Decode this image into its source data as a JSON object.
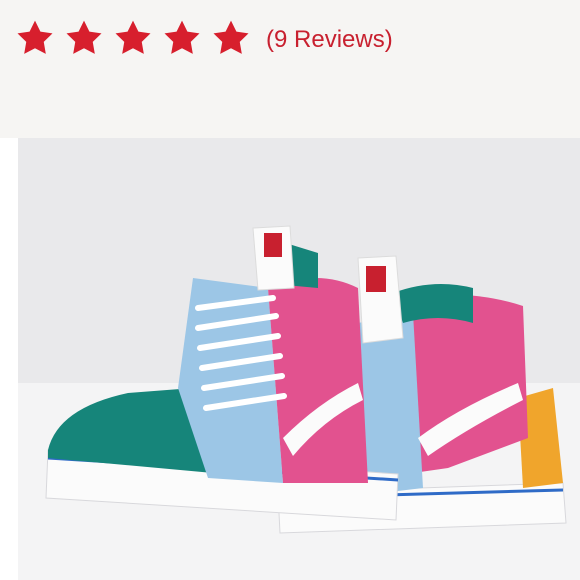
{
  "rating": {
    "value": 5,
    "max": 5,
    "star_color": "#d71f2d",
    "star_icon": "star-icon",
    "review_count_label": "(9 Reviews)"
  },
  "product": {
    "image_icon": "sneaker-photo",
    "colors": {
      "wall": "#e9e9eb",
      "floor": "#f5f5f6",
      "teal": "#16857a",
      "pink": "#e2528f",
      "light_blue": "#9cc6e6",
      "yellow": "#f0a52c",
      "white": "#fbfbfb",
      "blue_stripe": "#2f6bc7"
    }
  }
}
